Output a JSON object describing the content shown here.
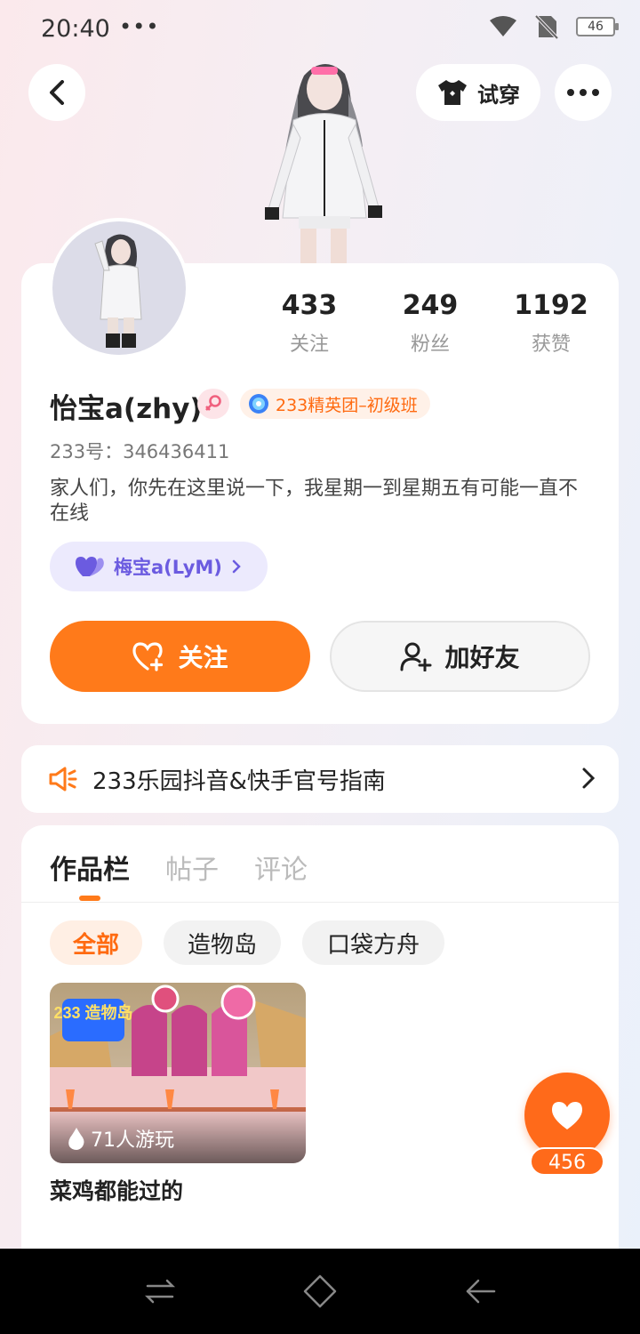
{
  "status_bar": {
    "time": "20:40",
    "dots": "•••",
    "battery": "46"
  },
  "header": {
    "tryon_label": "试穿"
  },
  "profile": {
    "stats": [
      {
        "value": "433",
        "label": "关注"
      },
      {
        "value": "249",
        "label": "粉丝"
      },
      {
        "value": "1192",
        "label": "获赞"
      }
    ],
    "username": "怡宝a(zhy)",
    "tag": "233精英团–初级班",
    "uid": "233号：346436411",
    "bio": "家人们，你先在这里说一下，我星期一到星期五有可能一直不在线",
    "pair": "梅宝a(LyM)",
    "follow_label": "关注",
    "add_friend_label": "加好友"
  },
  "notice": {
    "text": "233乐园抖音&快手官号指南"
  },
  "works": {
    "tabs": [
      "作品栏",
      "帖子",
      "评论"
    ],
    "filters": [
      "全部",
      "造物岛",
      "口袋方舟"
    ],
    "items": [
      {
        "title": "菜鸡都能过的",
        "plays": "71人游玩",
        "thumb_logo": "233 造物岛"
      }
    ]
  },
  "like": {
    "count": "456"
  },
  "colors": {
    "accent": "#ff7a1a",
    "tag_text": "#ff6a10",
    "pair_text": "#6b5be0"
  },
  "icons": [
    "back-icon",
    "tshirt-icon",
    "more-icon",
    "female-icon",
    "medal-icon",
    "heart-icon",
    "heart-plus-icon",
    "user-plus-icon",
    "megaphone-icon",
    "chevron-right-icon",
    "fire-icon",
    "nav-menu-icon",
    "nav-home-icon",
    "nav-back-icon"
  ]
}
